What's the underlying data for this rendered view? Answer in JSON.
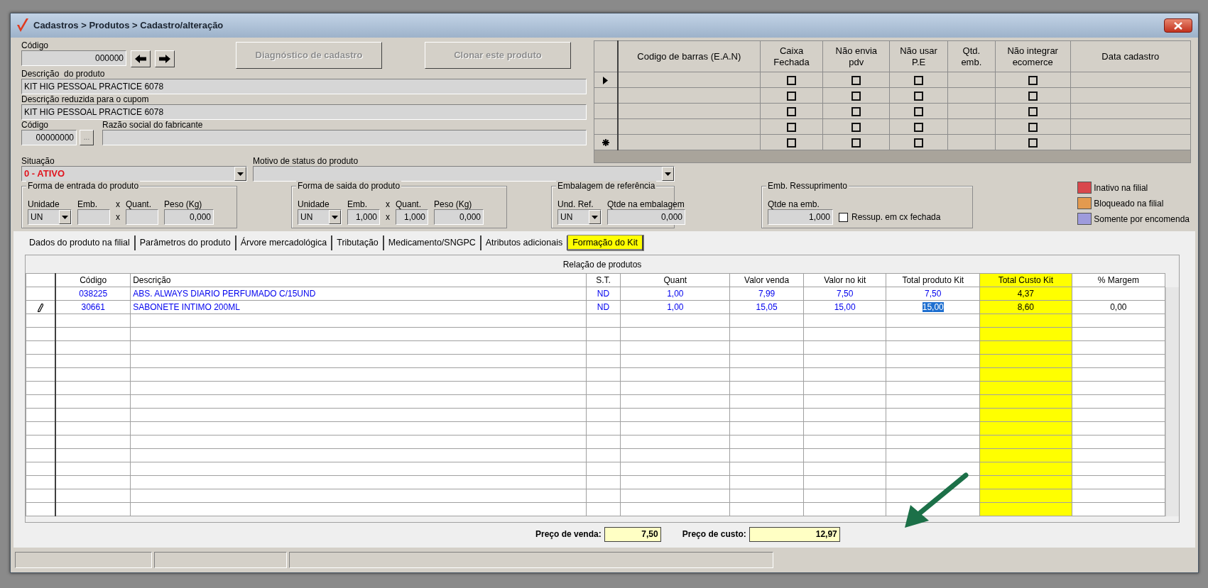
{
  "window": {
    "title": "Cadastros > Produtos > Cadastro/alteração"
  },
  "form": {
    "code": {
      "label": "Código",
      "value": "000000"
    },
    "buttons": [
      {
        "label": "Diagnóstico de cadastro",
        "disabled": true
      },
      {
        "label": "Clonar este produto",
        "disabled": true
      }
    ],
    "description": {
      "label": "Descrição  do produto",
      "value": "KIT HIG PESSOAL PRACTICE 6078"
    },
    "short_description": {
      "label": "Descrição reduzida para o cupom",
      "value": "KIT HIG PESSOAL PRACTICE 6078"
    },
    "manufacturer_code": {
      "label": "Código",
      "value": "00000000",
      "button": "..."
    },
    "manufacturer_name": {
      "label": "Razão social do fabricante"
    },
    "status": {
      "label": "Situação",
      "value": "0 - ATIVO"
    },
    "status_reason": {
      "label": "Motivo de status do produto"
    }
  },
  "barcode_grid": {
    "columns": [
      "Codigo de barras (E.A.N)",
      "Caixa Fechada",
      "Não envia pdv",
      "Não usar P.E",
      "Qtd. emb.",
      "Não integrar ecomerce",
      "Data cadastro"
    ],
    "rows": [
      {
        "current": true,
        "new": false,
        "caixa_fechada": false,
        "nao_envia_pdv": false,
        "nao_usar_pe": false,
        "nao_integrar_ecomerce": false
      },
      {
        "current": false,
        "new": false,
        "caixa_fechada": false,
        "nao_envia_pdv": false,
        "nao_usar_pe": false,
        "nao_integrar_ecomerce": false
      },
      {
        "current": false,
        "new": false,
        "caixa_fechada": false,
        "nao_envia_pdv": false,
        "nao_usar_pe": false,
        "nao_integrar_ecomerce": false
      },
      {
        "current": false,
        "new": false,
        "caixa_fechada": false,
        "nao_envia_pdv": false,
        "nao_usar_pe": false,
        "nao_integrar_ecomerce": false
      },
      {
        "current": false,
        "new": true,
        "caixa_fechada": false,
        "nao_envia_pdv": false,
        "nao_usar_pe": false,
        "nao_integrar_ecomerce": false
      }
    ]
  },
  "groups": [
    {
      "title": "Forma de entrada do produto",
      "fields": [
        {
          "kind": "select",
          "label": "Unidade",
          "value": "UN"
        },
        {
          "kind": "input",
          "label": "Emb."
        },
        {
          "kind": "times",
          "label": "x",
          "sign": "x"
        },
        {
          "kind": "input",
          "label": "Quant."
        },
        {
          "kind": "input",
          "label": "Peso (Kg)",
          "value": "0,000"
        }
      ]
    },
    {
      "title": "Forma de saida do produto",
      "fields": [
        {
          "kind": "select",
          "label": "Unidade",
          "value": "UN"
        },
        {
          "kind": "input",
          "label": "Emb.",
          "value": "1,000"
        },
        {
          "kind": "times",
          "label": "x",
          "sign": "x"
        },
        {
          "kind": "input",
          "label": "Quant.",
          "value": "1,000"
        },
        {
          "kind": "input",
          "label": "Peso (Kg)",
          "value": "0,000"
        }
      ]
    },
    {
      "title": "Embalagem de referência",
      "fields": [
        {
          "kind": "select",
          "label": "Und. Ref.",
          "value": "UN"
        },
        {
          "kind": "input",
          "label": "Qtde na embalagem",
          "value": "0,000"
        }
      ]
    },
    {
      "title": "Emb. Ressuprimento",
      "fields": [
        {
          "kind": "input",
          "label": "Qtde na emb.",
          "value": "1,000"
        },
        {
          "kind": "checkbox",
          "label": "Ressup. em cx fechada",
          "checked": false
        }
      ]
    }
  ],
  "legend": [
    {
      "label": "Inativo na filial",
      "color": "#d9474c"
    },
    {
      "label": "Bloqueado na filial",
      "color": "#e39a4f"
    },
    {
      "label": "Somente por encomenda",
      "color": "#9e9bdc"
    }
  ],
  "tabs": [
    {
      "label": "Dados do produto na filial",
      "selected": false,
      "highlighted": false
    },
    {
      "label": "Parâmetros do produto",
      "selected": false,
      "highlighted": false
    },
    {
      "label": "Árvore mercadológica",
      "selected": false,
      "highlighted": false
    },
    {
      "label": "Tributação",
      "selected": false,
      "highlighted": false
    },
    {
      "label": "Medicamento/SNGPC",
      "selected": false,
      "highlighted": false
    },
    {
      "label": "Atributos adicionais",
      "selected": false,
      "highlighted": false
    },
    {
      "label": "Formação do Kit",
      "selected": true,
      "highlighted": true
    }
  ],
  "kit_table": {
    "title": "Relação de produtos",
    "columns": [
      {
        "label": "Código",
        "highlighted": false
      },
      {
        "label": "Descrição",
        "highlighted": false
      },
      {
        "label": "S.T.",
        "highlighted": false
      },
      {
        "label": "Quant",
        "highlighted": false
      },
      {
        "label": "Valor venda",
        "highlighted": false
      },
      {
        "label": "Valor no kit",
        "highlighted": false
      },
      {
        "label": "Total produto Kit",
        "highlighted": false
      },
      {
        "label": "Total Custo Kit",
        "highlighted": true
      },
      {
        "label": "% Margem",
        "highlighted": false
      }
    ],
    "rows": [
      {
        "editing": false,
        "cells": [
          {
            "text": "038225",
            "selected": false
          },
          {
            "text": "ABS. ALWAYS DIARIO PERFUMADO C/15UND",
            "selected": false
          },
          {
            "text": "ND",
            "selected": false
          },
          {
            "text": "1,00",
            "selected": false
          },
          {
            "text": "7,99",
            "selected": false
          },
          {
            "text": "7,50",
            "selected": false
          },
          {
            "text": "7,50",
            "selected": false
          },
          {
            "text": "4,37",
            "selected": false
          }
        ]
      },
      {
        "editing": true,
        "cells": [
          {
            "text": "30661",
            "selected": false
          },
          {
            "text": "SABONETE INTIMO 200ML",
            "selected": false
          },
          {
            "text": "ND",
            "selected": false
          },
          {
            "text": "1,00",
            "selected": false
          },
          {
            "text": "15,05",
            "selected": false
          },
          {
            "text": "15,00",
            "selected": false
          },
          {
            "text": "15,00",
            "selected": true
          },
          {
            "text": "8,60",
            "selected": false
          },
          {
            "text": "0,00",
            "selected": false
          }
        ]
      }
    ]
  },
  "totals": [
    {
      "label": "Preço de venda:",
      "value": "7,50"
    },
    {
      "label": "Preço de custo:",
      "value": "12,97"
    }
  ]
}
